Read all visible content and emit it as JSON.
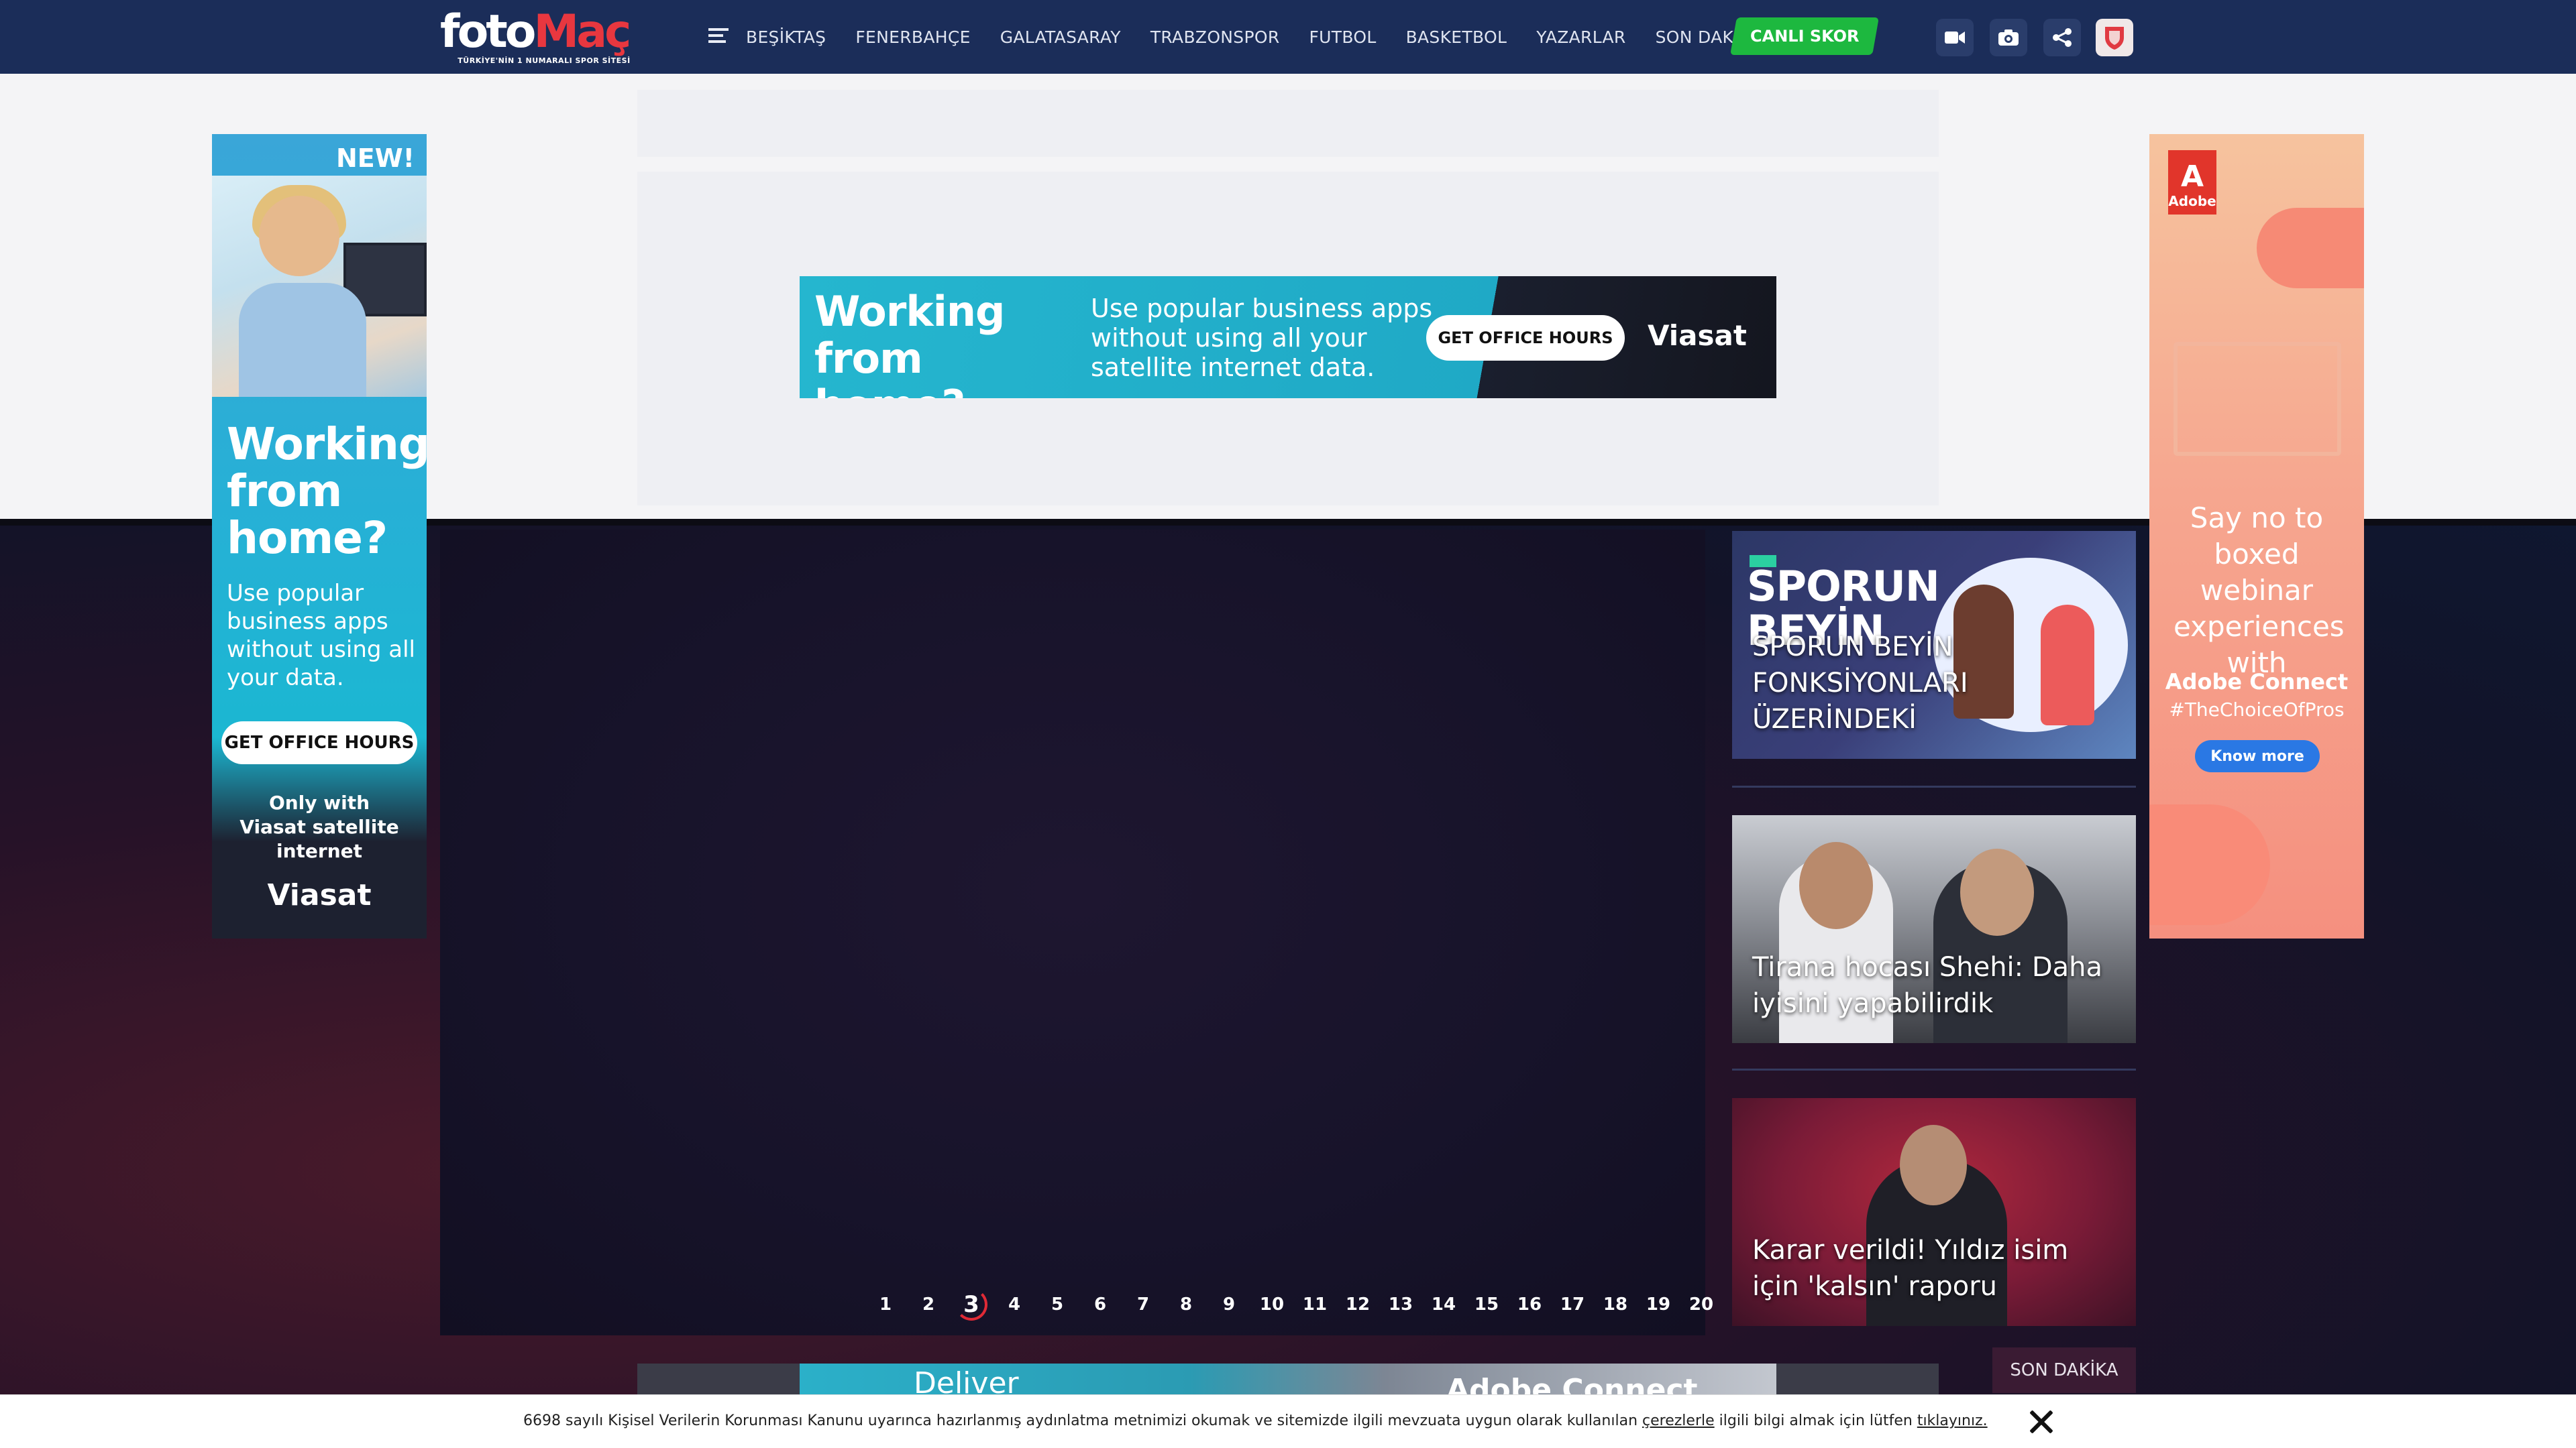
{
  "header": {
    "logo_main": "foto",
    "logo_accent": "Maç",
    "logo_tagline": "TÜRKİYE'NİN 1 NUMARALI SPOR SİTESİ",
    "nav": [
      "BEŞİKTAŞ",
      "FENERBAHÇE",
      "GALATASARAY",
      "TRABZONSPOR",
      "FUTBOL",
      "BASKETBOL",
      "YAZARLAR",
      "SON DAKİKA"
    ],
    "live_button": "CANLI SKOR",
    "icons": [
      "video-icon",
      "camera-icon",
      "share-icon",
      "team-badge-icon"
    ],
    "colors": {
      "nav_bg": "#1b2d59",
      "live_green": "#1db83f",
      "accent_red": "#e02a36"
    }
  },
  "ads": {
    "top_banner": {
      "headline": "Working from home?",
      "subline": "Use popular business apps without using all your satellite internet data.",
      "cta": "GET OFFICE HOURS",
      "brand": "Viasat"
    },
    "left_skyscraper": {
      "badge": "NEW!",
      "headline": "Working from home?",
      "subline": "Use popular business apps without using all your data.",
      "cta": "GET OFFICE HOURS",
      "note": "Only with Viasat satellite internet",
      "brand": "Viasat"
    },
    "right_skyscraper": {
      "logo": "Adobe",
      "headline": "Say no to boxed webinar experiences with",
      "brand": "Adobe Connect",
      "tag": "#TheChoiceOfPros",
      "cta": "Know more"
    },
    "bottom_banner": {
      "text_left": "Deliver",
      "text_right": "Adobe Connect"
    }
  },
  "gallery": {
    "pages": [
      "1",
      "2",
      "3",
      "4",
      "5",
      "6",
      "7",
      "8",
      "9",
      "10",
      "11",
      "12",
      "13",
      "14",
      "15",
      "16",
      "17",
      "18",
      "19",
      "20"
    ],
    "active_page": "3"
  },
  "sidebar": {
    "cards": [
      {
        "image_text": "SPORUN BEYİN",
        "title": "SPORUN BEYİN FONKSİYONLARI ÜZERİNDEKİ"
      },
      {
        "title": "Tirana hocası Shehi: Daha iyisini yapabilirdik"
      },
      {
        "title": "Karar verildi! Yıldız isim için 'kalsın' raporu"
      }
    ],
    "son_dakika": "SON DAKİKA"
  },
  "cookie": {
    "text_before": "6698 sayılı Kişisel Verilerin Korunması Kanunu uyarınca hazırlanmış aydınlatma metnimizi okumak ve sitemizde ilgili mevzuata uygun olarak kullanılan ",
    "link1": "çerezlerle",
    "text_middle": " ilgili bilgi almak için lütfen ",
    "link2": "tıklayınız."
  }
}
